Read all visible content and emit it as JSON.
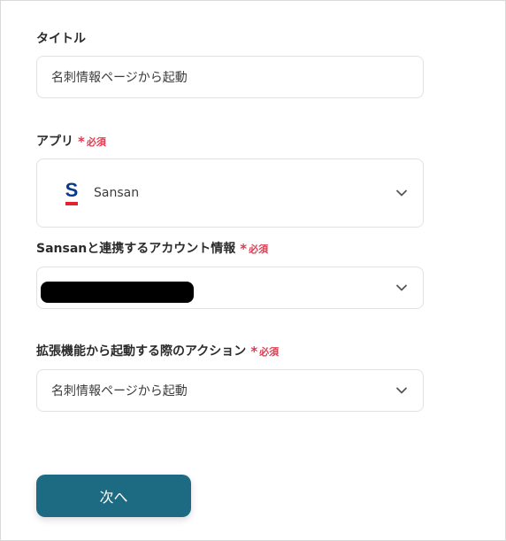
{
  "form": {
    "title_field": {
      "label": "タイトル",
      "value": "名刺情報ページから起動"
    },
    "app_field": {
      "label": "アプリ",
      "required_mark": "*",
      "required_text": "必須",
      "app_name": "Sansan",
      "logo_letter": "S",
      "logo_colors": {
        "letter": "#0a3a8c",
        "bar": "#e3232b"
      },
      "icon": "chevron-down-icon"
    },
    "account_field": {
      "label": "Sansanと連携するアカウント情報",
      "required_mark": "*",
      "required_text": "必須",
      "value_redacted": true,
      "icon": "chevron-down-icon"
    },
    "action_field": {
      "label": "拡張機能から起動する際のアクション",
      "required_mark": "*",
      "required_text": "必須",
      "value": "名刺情報ページから起動",
      "icon": "chevron-down-icon"
    },
    "next_button": {
      "label": "次へ",
      "color": "#1d6b82"
    }
  },
  "colors": {
    "required": "#e5384f",
    "field_border": "#e2e2e2"
  }
}
